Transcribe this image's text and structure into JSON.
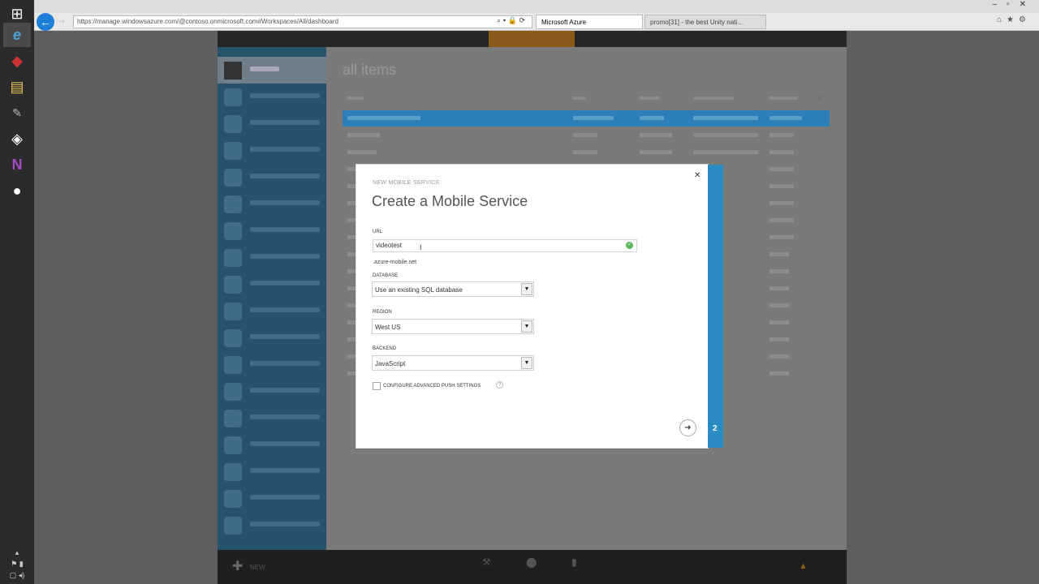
{
  "browser": {
    "address": "https://manage.windowsazure.com/@contoso.onmicrosoft.com#Workspaces/All/dashboard",
    "tabs": [
      {
        "label": "Microsoft Azure",
        "active": true
      },
      {
        "label": "promo[31] - the best Unity nati..."
      }
    ]
  },
  "taskbar": {
    "apps": [
      "windows-start-icon",
      "internet-explorer-icon",
      "app-icon",
      "file-explorer-icon",
      "tools-icon",
      "unity-icon",
      "onenote-icon",
      "obs-icon"
    ]
  },
  "portal": {
    "section_title": "all items",
    "command_new": "NEW"
  },
  "dialog": {
    "subtitle": "NEW MOBILE SERVICE",
    "title": "Create a Mobile Service",
    "url_label": "URL",
    "url_value": "videotest",
    "url_suffix": ".azure-mobile.net",
    "database_label": "DATABASE",
    "database_value": "Use an existing SQL database",
    "region_label": "REGION",
    "region_value": "West US",
    "backend_label": "BACKEND",
    "backend_value": "JavaScript",
    "push_label": "CONFIGURE ADVANCED PUSH SETTINGS",
    "step": "2"
  },
  "colors": {
    "accent": "#2b8cc4",
    "sidebar": "#27526b",
    "success": "#5cb85c"
  }
}
